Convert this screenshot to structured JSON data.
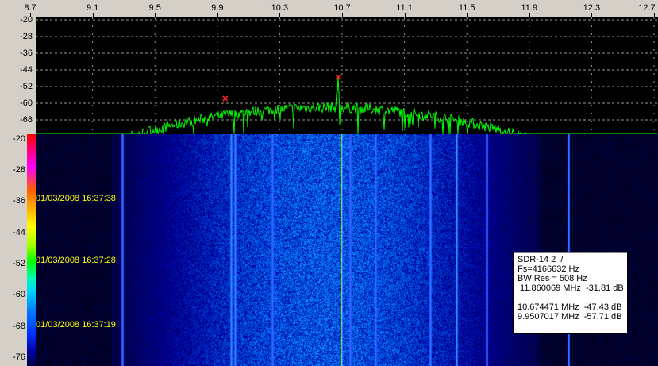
{
  "freq_axis": {
    "min": 8.7,
    "max": 12.7,
    "ticks": [
      "8.7",
      "9.1",
      "9.5",
      "9.9",
      "10.3",
      "10.7",
      "11.1",
      "11.5",
      "11.9",
      "12.3",
      "12.7"
    ]
  },
  "spectrum_axis": {
    "ticks": [
      "-20",
      "-28",
      "-36",
      "-44",
      "-52",
      "-60",
      "-68"
    ]
  },
  "waterfall_axis": {
    "ticks": [
      "-20",
      "-28",
      "-36",
      "-44",
      "-52",
      "-60",
      "-68",
      "-76"
    ]
  },
  "timestamps": [
    "01/03/2008 16:37:38",
    "01/03/2008 16:37:28",
    "01/03/2008 16:37:19"
  ],
  "peak_markers": [
    {
      "freq_mhz": 9.9507017,
      "db": -57.71
    },
    {
      "freq_mhz": 10.674471,
      "db": -47.43
    }
  ],
  "info": {
    "line1": "SDR-14 2  /",
    "line2": "Fs=4166632 Hz",
    "line3": "BW Res = 508 Hz",
    "line4": " 11.860069 MHz  -31.81 dB",
    "line5": "10.674471 MHz  -47.43 dB",
    "line6": "9.9507017 MHz  -57.71 dB"
  },
  "colors": {
    "trace": "#00ff00",
    "marker": "#ff2020",
    "grid": "#9a9a9a",
    "timestamp": "#ffff00"
  }
}
